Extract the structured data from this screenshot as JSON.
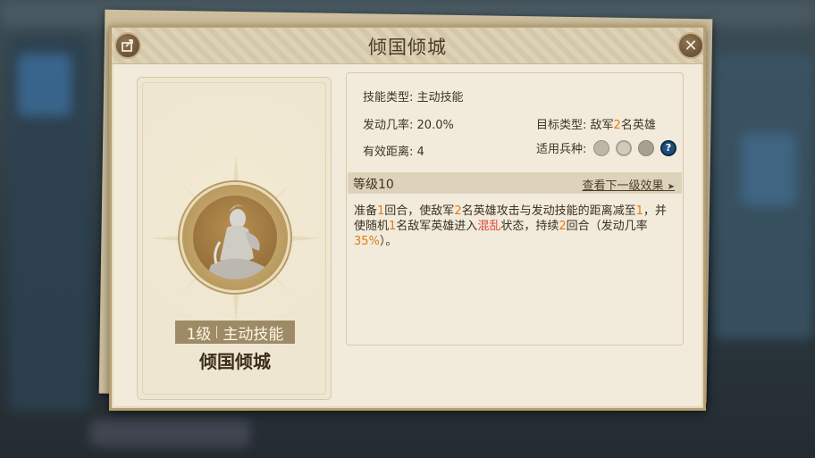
{
  "dialog": {
    "title": "倾国倾城",
    "close_symbol": "✕"
  },
  "skill": {
    "level_text": "1级",
    "category_text": "主动技能",
    "name": "倾国倾城"
  },
  "info": {
    "type_label": "技能类型:",
    "type_value": "主动技能",
    "rate_label": "发动几率:",
    "rate_value": "20.0%",
    "target_label": "目标类型:",
    "target_prefix": "敌军",
    "target_num": "2",
    "target_suffix": "名英雄",
    "range_label": "有效距离:",
    "range_value": "4",
    "troop_label": "适用兵种:",
    "troop_icons": [
      "blade-icon",
      "target-icon",
      "horse-icon",
      "help-icon"
    ],
    "help_symbol": "?"
  },
  "level_bar": {
    "label": "等级10",
    "next_link": "查看下一级效果",
    "arrow": "➤"
  },
  "description": {
    "p1": "准备",
    "n1": "1",
    "p2": "回合，使敌军",
    "n2": "2",
    "p3": "名英雄攻击与发动技能的距离减至",
    "n3": "1",
    "p4": "，并使随机",
    "n4": "1",
    "p5": "名敌军英雄进入",
    "status": "混乱",
    "p6": "状态，持续",
    "n5": "2",
    "p7": "回合（发动几率",
    "n6": "35%",
    "p8": "）。"
  },
  "colors": {
    "highlight_number": "#e17b15",
    "highlight_status": "#e2443a",
    "panel_bg": "#f2ebdb"
  }
}
